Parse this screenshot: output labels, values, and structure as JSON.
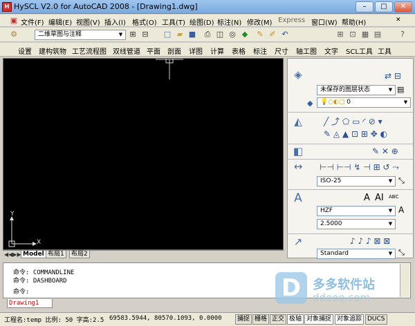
{
  "window": {
    "title": "HySCL V2.0 for AutoCAD 2008 - [Drawing1.dwg]",
    "app_icon": "H",
    "min": "–",
    "max": "□",
    "close": "✕"
  },
  "menu": {
    "items": [
      "文件(F)",
      "编辑(E)",
      "视图(V)",
      "插入(I)",
      "格式(O)",
      "工具(T)",
      "绘图(D)",
      "标注(N)",
      "修改(M)",
      "Express",
      "窗口(W)",
      "帮助(H)"
    ]
  },
  "toolbar1": {
    "view_dropdown": "二维草图与注释"
  },
  "toolbar2": {
    "items": [
      "设置",
      "建构筑物",
      "工艺流程图",
      "双线管道",
      "平面",
      "剖面",
      "详图",
      "计算",
      "表格",
      "标注",
      "尺寸",
      "轴工图",
      "文字",
      "SCL工具",
      "工具"
    ]
  },
  "drawing": {
    "ucs_x": "X",
    "ucs_y": "Y"
  },
  "layout_tabs": [
    "Model",
    "布局1",
    "布局2"
  ],
  "panel": {
    "layer_state": "未保存的图层状态",
    "layer_value": "0",
    "dim_style": "ISO-25",
    "text_style": "HZF",
    "text_height": "2.5000",
    "table_style": "Standard",
    "text_icon_a": "A",
    "text_icon_ai": "AI",
    "text_icon_abc": "ABC"
  },
  "command": {
    "lines": [
      "命令: COMMANDLINE",
      "命令: DASHBOARD",
      "命令:"
    ]
  },
  "cmd_tab": "Drawing1",
  "status": {
    "layer_info": "工程名:temp 比例: 50  字高:2.5",
    "coords": "69583.5944,  80570.1093, 0.0000",
    "buttons": [
      "捕捉",
      "栅格",
      "正交",
      "极轴",
      "对象捕捉",
      "对象追踪",
      "DUCS"
    ]
  },
  "watermark": {
    "text": "多多软件站",
    "url": "ddooo.com",
    "letter": "D"
  }
}
